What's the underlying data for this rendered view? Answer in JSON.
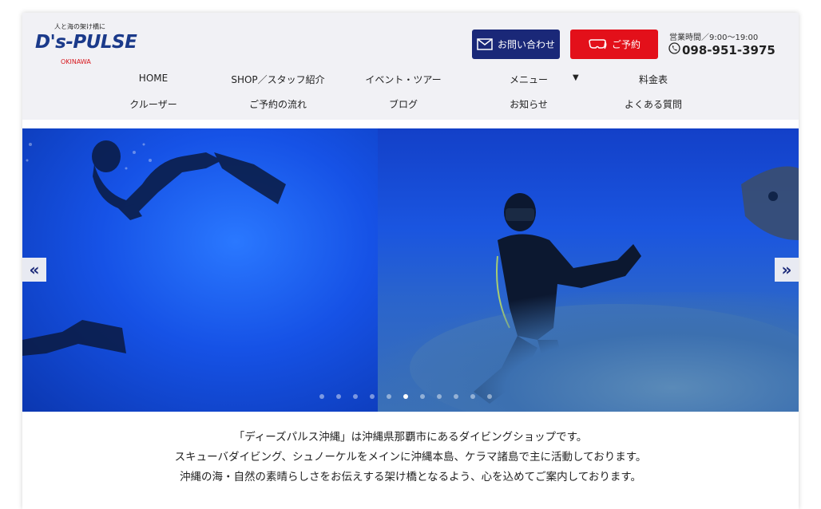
{
  "logo": {
    "tagline": "人と海の架け橋に",
    "name": "D's-PULSE",
    "region": "OKINAWA"
  },
  "header": {
    "contact_label": "お問い合わせ",
    "reserve_label": "ご予約",
    "hours": "営業時間／9:00〜19:00",
    "phone": "098-951-3975"
  },
  "nav": {
    "row1": [
      "HOME",
      "SHOP／スタッフ紹介",
      "イベント・ツアー",
      "メニュー",
      "料金表"
    ],
    "row2": [
      "クルーザー",
      "ご予約の流れ",
      "ブログ",
      "お知らせ",
      "よくある質問"
    ]
  },
  "slider": {
    "prev_icon": "double-chevron-left",
    "next_icon": "double-chevron-right",
    "dot_count": 11,
    "active_dot": 5
  },
  "intro": {
    "lines": [
      "「ディーズパルス沖縄」は沖縄県那覇市にあるダイビングショップです。",
      "スキューバダイビング、シュノーケルをメインに沖縄本島、ケラマ諸島で主に活動しております。",
      "沖縄の海・自然の素晴らしさをお伝えする架け橋となるよう、心を込めてご案内しております。"
    ]
  },
  "colors": {
    "brand_navy": "#1a2878",
    "brand_red": "#e3101a",
    "header_bg": "#f1f1f5",
    "ocean_blue": "#1652e6"
  }
}
